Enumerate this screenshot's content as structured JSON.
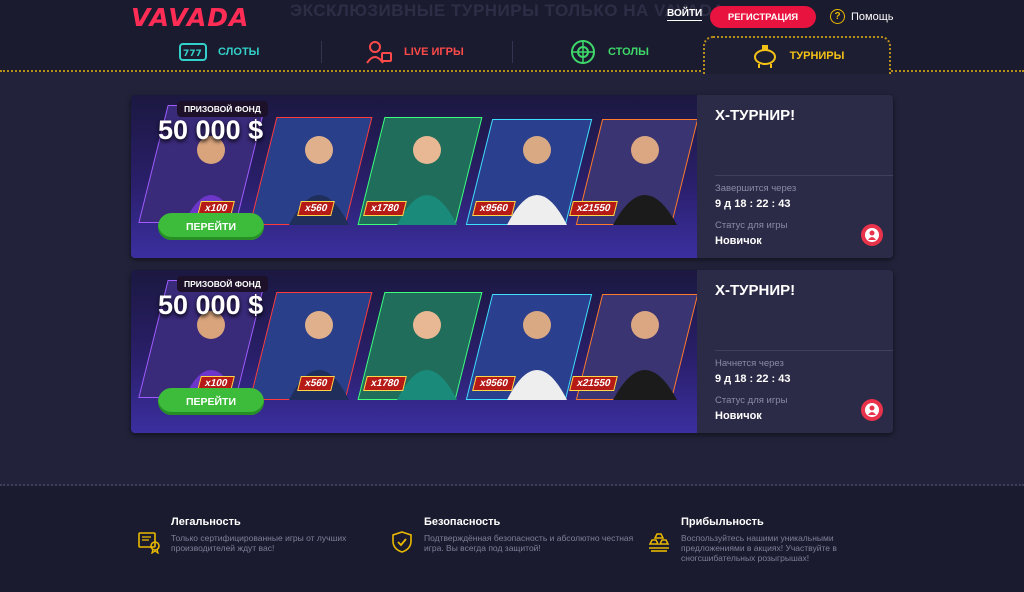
{
  "header": {
    "logo": "VAVADA",
    "ghost_title": "ЭКСКЛЮЗИВНЫЕ ТУРНИРЫ ТОЛЬКО НА VAVADA",
    "login": "ВОЙТИ",
    "register": "РЕГИСТРАЦИЯ",
    "help": "Помощь"
  },
  "nav": {
    "tabs": [
      {
        "label": "СЛОТЫ",
        "icon": "slots-icon",
        "color": "#32d1c9"
      },
      {
        "label": "LIVE ИГРЫ",
        "icon": "live-games-icon",
        "color": "#ff4a4a"
      },
      {
        "label": "СТОЛЫ",
        "icon": "roulette-icon",
        "color": "#3ed96a"
      },
      {
        "label": "ТУРНИРЫ",
        "icon": "piggy-bank-icon",
        "color": "#f4c216",
        "active": true
      }
    ]
  },
  "tournaments": [
    {
      "prize_label": "ПРИЗОВОЙ ФОНД",
      "prize_amount": "50 000 $",
      "multipliers": [
        "x100",
        "x560",
        "x1780",
        "x9560",
        "x21550"
      ],
      "button": "ПЕРЕЙТИ",
      "title": "X-ТУРНИР!",
      "timer_label": "Завершится через",
      "timer_value": "9 д 18 : 22 : 43",
      "status_label": "Статус для игры",
      "status_value": "Новичок"
    },
    {
      "prize_label": "ПРИЗОВОЙ ФОНД",
      "prize_amount": "50 000 $",
      "multipliers": [
        "x100",
        "x560",
        "x1780",
        "x9560",
        "x21550"
      ],
      "button": "ПЕРЕЙТИ",
      "title": "X-ТУРНИР!",
      "timer_label": "Начнется через",
      "timer_value": "9 д 18 : 22 : 43",
      "status_label": "Статус для игры",
      "status_value": "Новичок"
    }
  ],
  "footer": {
    "features": [
      {
        "icon": "certificate-icon",
        "title": "Легальность",
        "text": "Только сертифицированные игры от лучших производителей ждут вас!"
      },
      {
        "icon": "shield-check-icon",
        "title": "Безопасность",
        "text": "Подтверждённая безопасность и абсолютно честная игра. Вы всегда под защитой!"
      },
      {
        "icon": "gold-bars-icon",
        "title": "Прибыльность",
        "text": "Воспользуйтесь нашими уникальными предложениями в акциях! Участвуйте в сногсшибательных розыгрышах!"
      }
    ]
  },
  "colors": {
    "brand": "#ff2d55",
    "register": "#e8133e",
    "go_button": "#3dbb3a",
    "accent_gold": "#f4c216"
  }
}
